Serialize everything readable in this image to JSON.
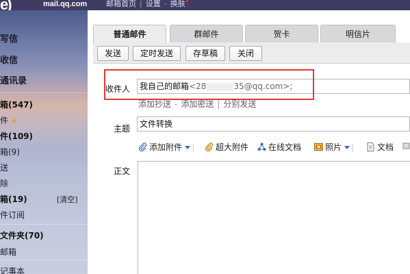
{
  "header": {
    "logo_mark": "e)",
    "logo_text": "mail.qq.com",
    "links": [
      "邮箱首页",
      "设置",
      "换肤"
    ]
  },
  "sidebar": {
    "items": [
      {
        "label": "写信"
      },
      {
        "label": "收信"
      },
      {
        "label": "通讯录"
      },
      {
        "label": "箱(547)"
      },
      {
        "label": "件"
      },
      {
        "label": "件(109)"
      },
      {
        "label": "箱(9)"
      },
      {
        "label": "送"
      },
      {
        "label": "除"
      },
      {
        "label": "箱(19)"
      },
      {
        "label": "件订阅"
      },
      {
        "label": "文件夹(70)"
      },
      {
        "label": "邮箱"
      },
      {
        "label": "记事本"
      }
    ],
    "clear_label": "[清空]"
  },
  "tabs": [
    {
      "label": "普通邮件"
    },
    {
      "label": "群邮件"
    },
    {
      "label": "贺卡"
    },
    {
      "label": "明信片"
    }
  ],
  "toolbar": {
    "send": "发送",
    "timed_send": "定时发送",
    "save_draft": "存草稿",
    "close": "关闭"
  },
  "compose": {
    "to_label": "收件人",
    "recipient_name": "我自己的邮箱",
    "recipient_email_prefix": "<28",
    "recipient_email_suffix": "35@qq.com>;",
    "add_cc": "添加抄送",
    "add_bcc": "添加密送",
    "separate_send": "分别发送",
    "subject_label": "主题",
    "subject_value": "文件转换",
    "body_label": "正文"
  },
  "attachments": {
    "add_attachment": "添加附件",
    "large_attachment": "超大附件",
    "online_doc": "在线文档",
    "photo": "照片",
    "document": "文档"
  },
  "colors": {
    "topbar": "#3e3c63",
    "highlight": "#e73535",
    "star": "#e7a21b"
  }
}
